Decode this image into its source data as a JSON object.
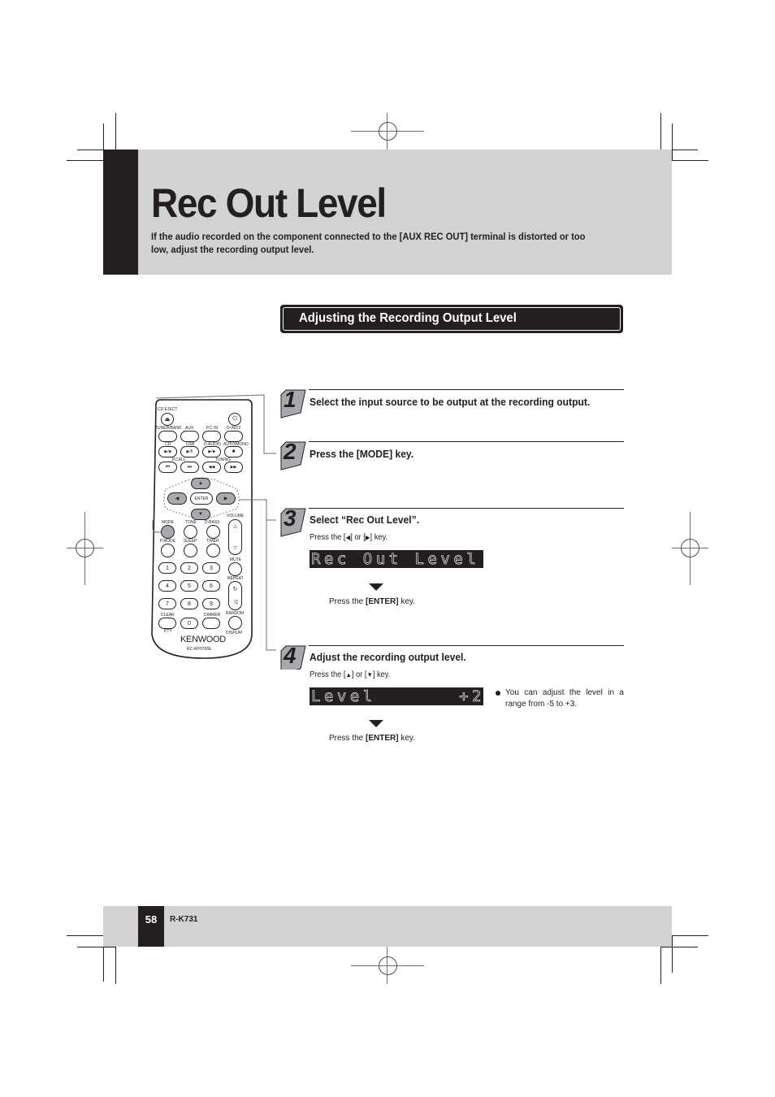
{
  "page": {
    "title": "Rec Out Level",
    "intro": "If the audio recorded on the component connected to the [AUX REC OUT] terminal is distorted or too low, adjust the recording output level.",
    "section_title": "Adjusting the Recording Output Level",
    "colors": {
      "band": "#d1d2d4",
      "ink": "#231f20",
      "step_tab": "#a7a9ac"
    }
  },
  "steps": [
    {
      "number": "1",
      "heading": "Select the input source to be output at the recording output."
    },
    {
      "number": "2",
      "heading": "Press the [MODE] key."
    },
    {
      "number": "3",
      "heading": "Select “Rec Out Level”.",
      "instruction_prefix": "Press the [",
      "instruction_mid": "] or [",
      "instruction_suffix": "] key.",
      "icon_a": "◀",
      "icon_b": "▶",
      "display": "Rec Out Level",
      "confirm_prefix": "Press the ",
      "confirm_key": "[ENTER]",
      "confirm_suffix": " key."
    },
    {
      "number": "4",
      "heading": "Adjust the recording output level.",
      "instruction_prefix": "Press the [",
      "instruction_mid": "] or [",
      "instruction_suffix": "] key.",
      "icon_a": "▲",
      "icon_b": "▼",
      "display_left": "Level",
      "display_right": "+2",
      "note": "You can adjust the level in a range from -5 to +3.",
      "confirm_prefix": "Press the ",
      "confirm_key": "[ENTER]",
      "confirm_suffix": " key."
    }
  ],
  "remote": {
    "brand": "KENWOOD",
    "model": "RC-RP0706E",
    "labels": {
      "cd_eject": "CD EJECT",
      "tuner_band": "TUNER/BAND",
      "aux": "AUX",
      "pc_in": "P.C IN",
      "d_in": "D-IN1/2",
      "cd": "CD",
      "usb": "USB",
      "d_audio": "D.AUDIO",
      "auto_mono": "AUTO/MONO",
      "p_call": "P.CALL",
      "tuning": "TUNING",
      "enter": "ENTER",
      "mode": "MODE",
      "tone": "TONE",
      "d_bass": "D-BASS",
      "volume": "VOLUME",
      "p_mode": "P.MODE",
      "sleep": "SLEEP",
      "timer": "TIMER",
      "mute": "MUTE",
      "repeat": "REPEAT",
      "random": "RANDOM",
      "clear": "CLEAR",
      "dimmer": "DIMMER",
      "pty": "PTY",
      "display": "DISPLAY"
    },
    "digits": [
      "1",
      "2",
      "3",
      "4",
      "5",
      "6",
      "7",
      "8",
      "9",
      "0"
    ],
    "transport_icons": {
      "eject": "⏏",
      "power": "⏻",
      "play_stop": "▶/■",
      "play_pause": "▶/II",
      "stop": "■",
      "prev": "⏮",
      "next": "⏭",
      "rew": "◀◀",
      "ff": "▶▶",
      "repeat": "↻",
      "shuffle": "⤨"
    }
  },
  "footer": {
    "page_number": "58",
    "model": "R-K731"
  }
}
